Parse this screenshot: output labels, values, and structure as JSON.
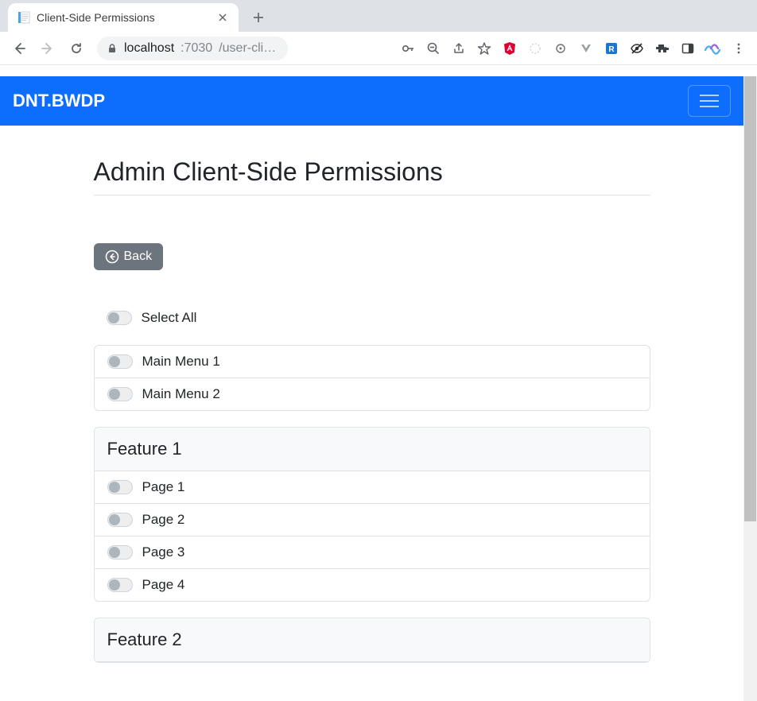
{
  "window": {
    "tab_title": "Client-Side Permissions",
    "url_host": "localhost",
    "url_port": ":7030",
    "url_path": "/user-cli…"
  },
  "navbar": {
    "brand": "DNT.BWDP"
  },
  "page": {
    "title": "Admin Client-Side Permissions",
    "back_label": "Back",
    "select_all_label": "Select All"
  },
  "menus": {
    "items": [
      {
        "label": "Main Menu 1"
      },
      {
        "label": "Main Menu 2"
      }
    ]
  },
  "features": [
    {
      "title": "Feature 1",
      "pages": [
        {
          "label": "Page 1"
        },
        {
          "label": "Page 2"
        },
        {
          "label": "Page 3"
        },
        {
          "label": "Page 4"
        }
      ]
    },
    {
      "title": "Feature 2",
      "pages": []
    }
  ]
}
